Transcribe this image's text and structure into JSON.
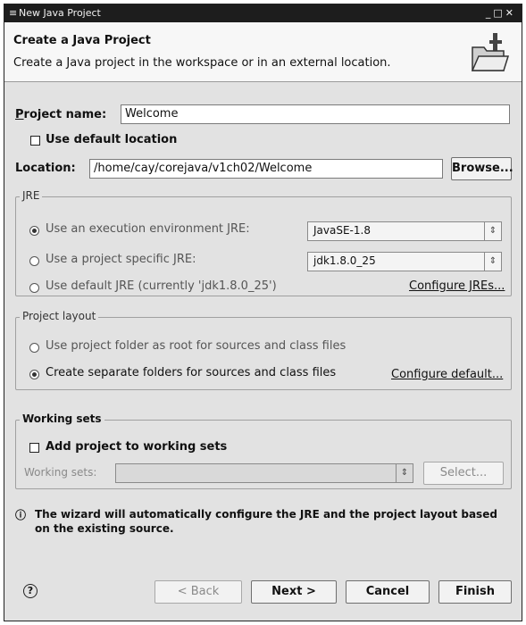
{
  "window": {
    "title": "New Java Project"
  },
  "banner": {
    "heading": "Create a Java Project",
    "description": "Create a Java project in the workspace or in an external location."
  },
  "project_name": {
    "label": "Project name:",
    "value": "Welcome"
  },
  "default_location": {
    "label": "Use default location",
    "checked": false
  },
  "location": {
    "label": "Location:",
    "value": "/home/cay/corejava/v1ch02/Welcome",
    "browse_label": "Browse..."
  },
  "jre": {
    "group_label": "JRE",
    "option_env": {
      "label": "Use an execution environment JRE:",
      "selected": true,
      "combo_value": "JavaSE-1.8"
    },
    "option_specific": {
      "label": "Use a project specific JRE:",
      "selected": false,
      "combo_value": "jdk1.8.0_25"
    },
    "option_default": {
      "label": "Use default JRE (currently 'jdk1.8.0_25')",
      "selected": false
    },
    "configure_link": "Configure JREs..."
  },
  "layout": {
    "group_label": "Project layout",
    "option_root": {
      "label": "Use project folder as root for sources and class files",
      "selected": false
    },
    "option_separate": {
      "label": "Create separate folders for sources and class files",
      "selected": true
    },
    "configure_link": "Configure default..."
  },
  "working_sets": {
    "group_label": "Working sets",
    "add_label": "Add project to working sets",
    "add_checked": false,
    "sets_label": "Working sets:",
    "select_label": "Select..."
  },
  "info": {
    "icon": "info-icon",
    "message": "The wizard will automatically configure the JRE and the project layout based on the existing source."
  },
  "footer": {
    "help_icon": "help-icon",
    "back_label": "< Back",
    "next_label": "Next >",
    "cancel_label": "Cancel",
    "finish_label": "Finish"
  }
}
